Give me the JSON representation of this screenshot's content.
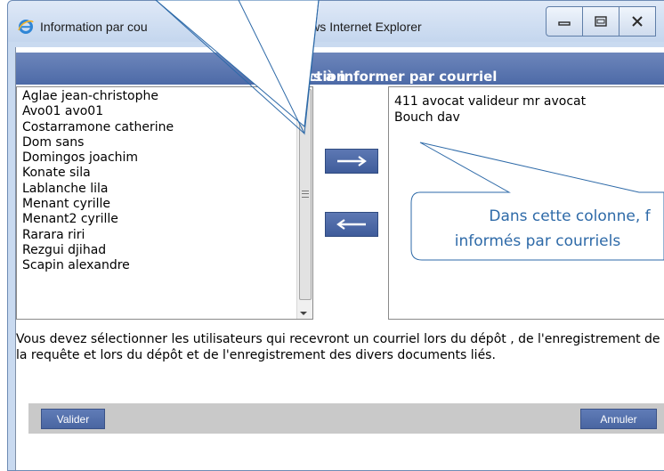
{
  "window": {
    "title": "Information par courriel des utilisateurs - Windows Internet Explorer",
    "title_visible": "Information par cou",
    "title_visible_right": "urs - Windows Internet Explorer",
    "controls": [
      "minimize-icon",
      "maximize-icon",
      "close-icon"
    ]
  },
  "header": {
    "title_left": "Sélection",
    "title_right": "onnes à informer par courriel"
  },
  "available_users": [
    "Aglae jean-christophe",
    "Avo01 avo01",
    "Costarramone catherine",
    "Dom sans",
    "Domingos joachim",
    "Konate sila",
    "Lablanche lila",
    "Menant cyrille",
    "Menant2 cyrille",
    "Rarara riri",
    "Rezgui djihad",
    "Scapin alexandre"
  ],
  "selected_users": [
    "411 avocat valideur mr avocat",
    "Bouch dav"
  ],
  "arrows": {
    "add": "⟶",
    "remove": "⟵"
  },
  "info_text": "Vous devez sélectionner les utilisateurs qui recevront un courriel lors du dépôt , de l'enregistrement de la requête et lors du dépôt et de l'enregistrement des divers documents liés.",
  "footer": {
    "validate_label": "Valider",
    "cancel_label": "Annuler"
  },
  "callout": {
    "line1": "Dans cette colonne, f",
    "line2": "informés par courriels"
  },
  "colors": {
    "header_bar": "#5a75b0",
    "button_bg": "#4f6aa6",
    "callout_text": "#2e6aa8",
    "footer_bar": "#c9c9c9"
  }
}
